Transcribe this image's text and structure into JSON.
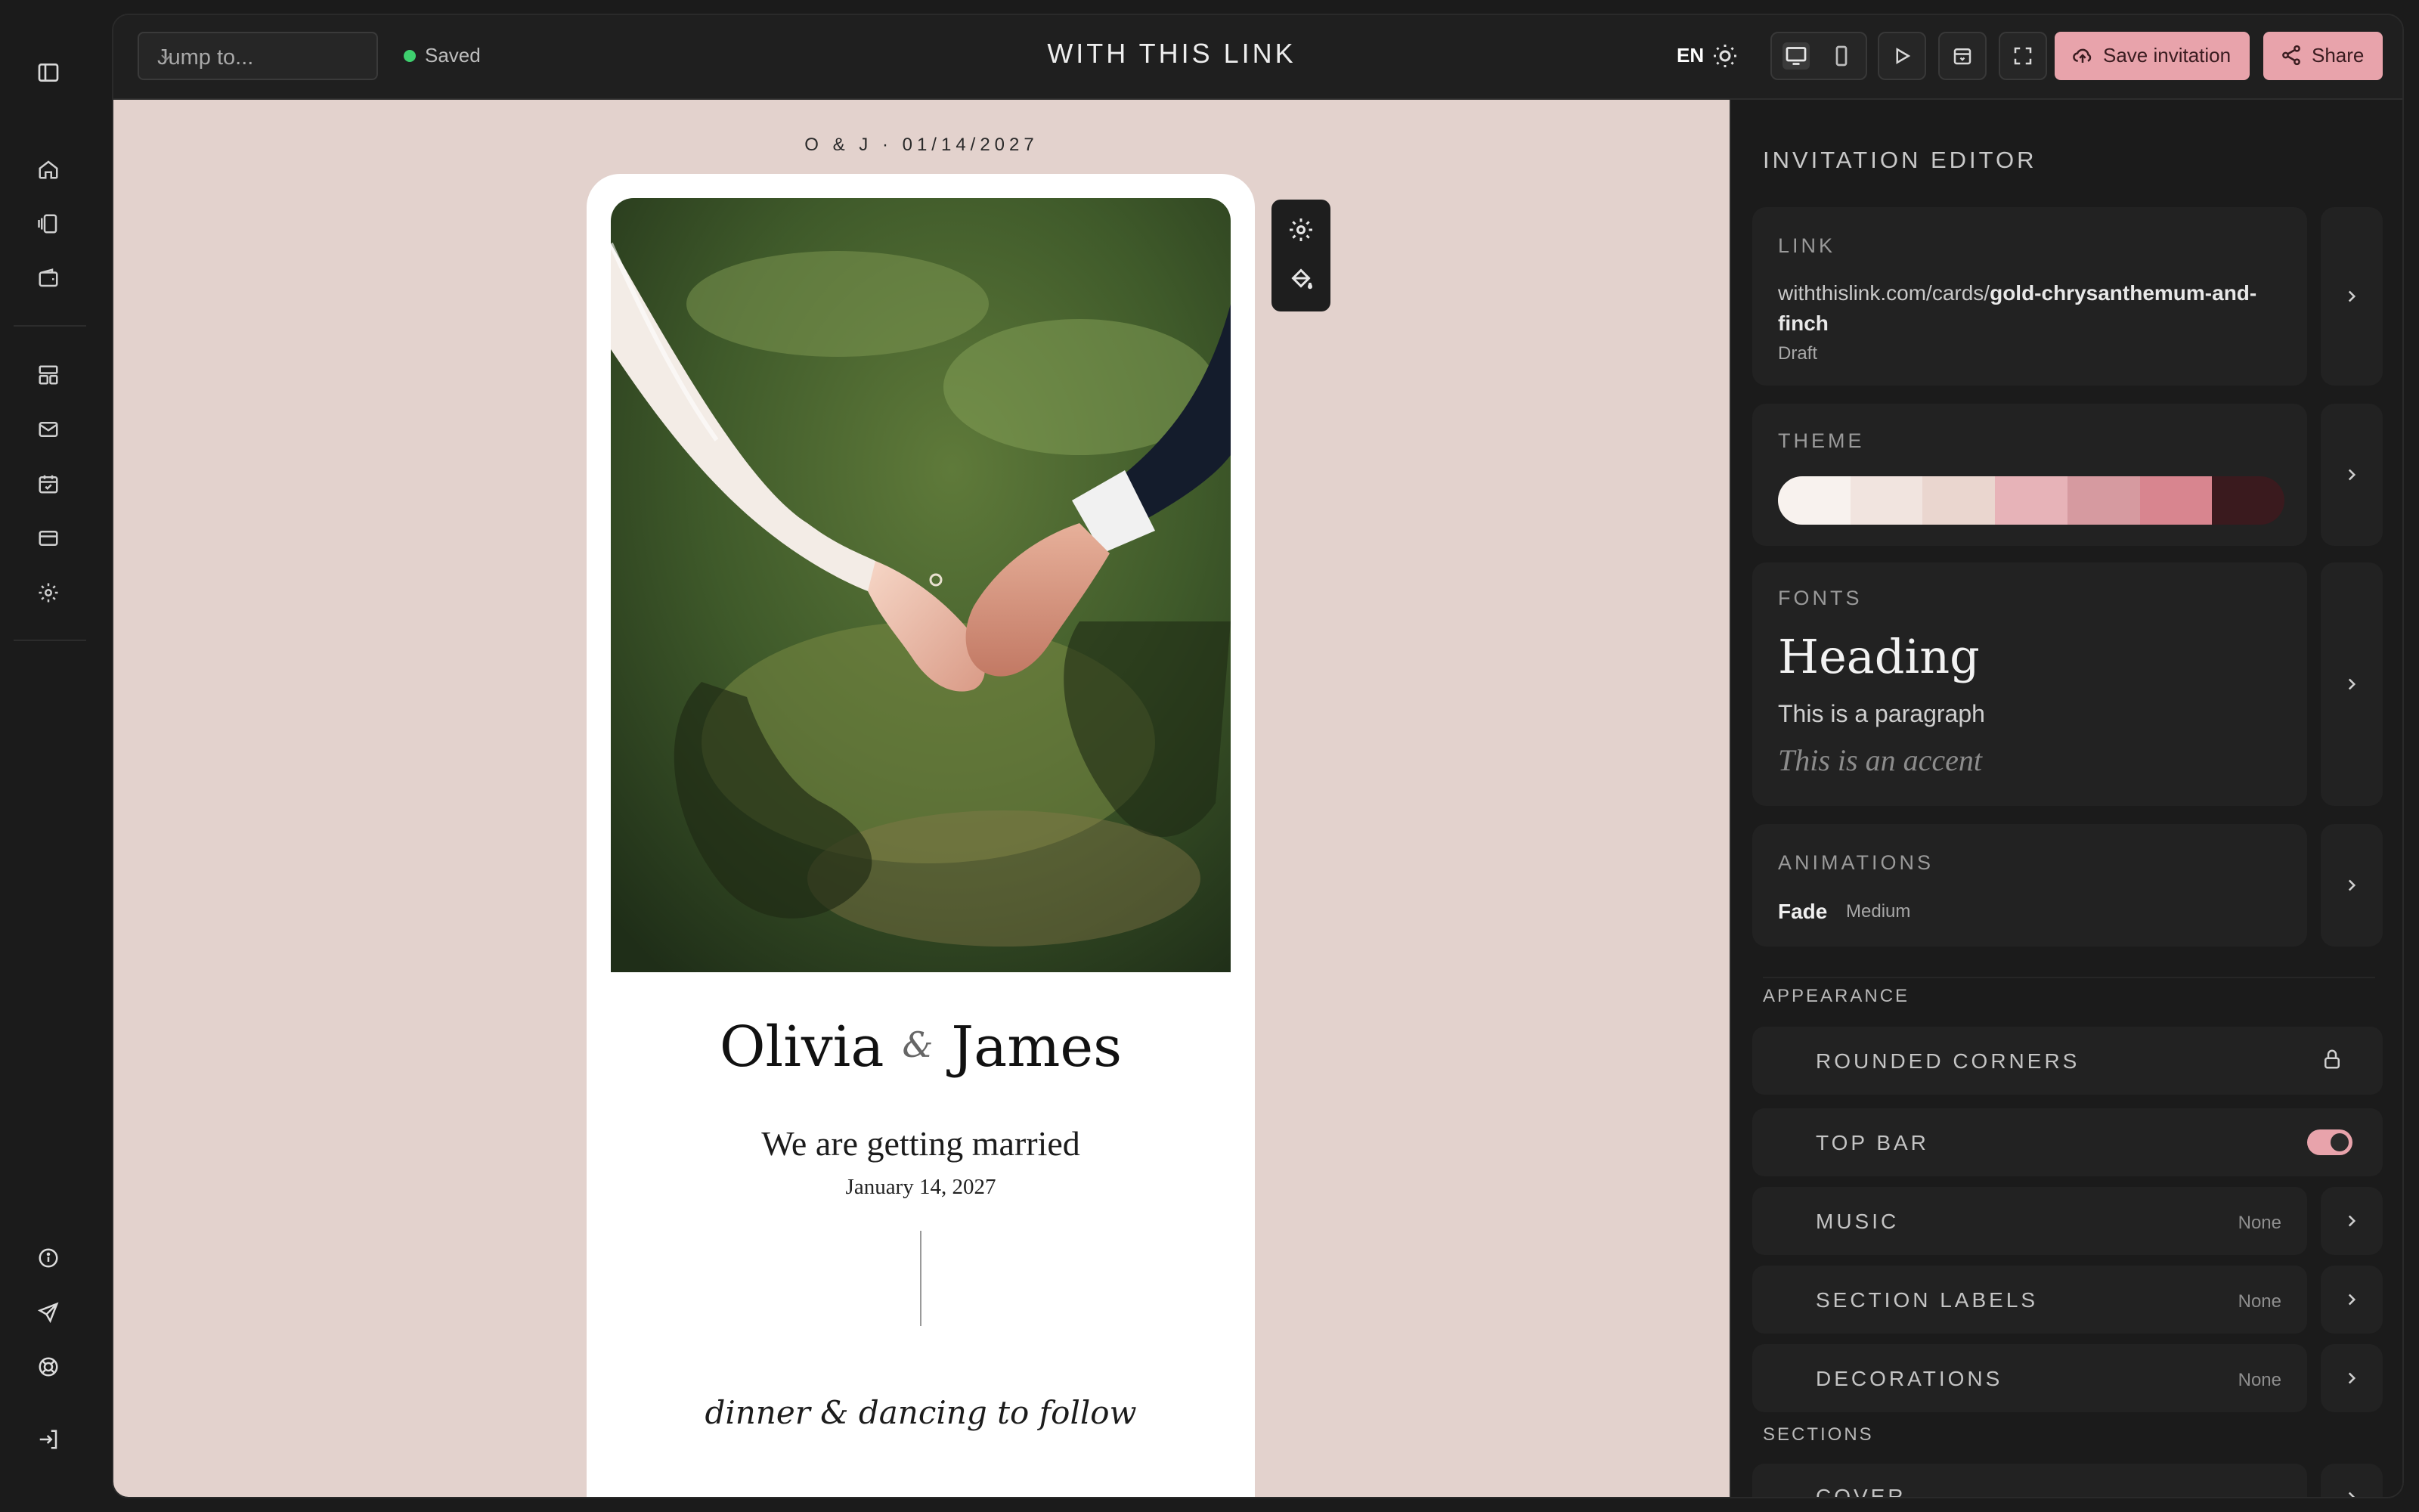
{
  "topbar": {
    "jump_placeholder": "Jump to...",
    "saved_status": "Saved",
    "app_title": "WITH THIS LINK",
    "language": "EN",
    "save_label": "Save invitation",
    "share_label": "Share"
  },
  "canvas": {
    "card_meta": "O & J  ·  01/14/2027",
    "name_left": "Olivia",
    "ampersand": "&",
    "name_right": "James",
    "tagline": "We are getting married",
    "date": "January 14, 2027",
    "follow_text": "dinner & dancing to follow"
  },
  "editor": {
    "title": "INVITATION EDITOR",
    "link": {
      "label": "LINK",
      "url_prefix": "withthislink.com/cards/",
      "url_slug": "gold-chrysanthemum-and-finch",
      "status": "Draft"
    },
    "theme": {
      "label": "THEME",
      "swatches": [
        "#f8f2ee",
        "#f1e4df",
        "#ead6cf",
        "#e7b3b8",
        "#d69aa0",
        "#d8858f",
        "#3a1a1e"
      ]
    },
    "fonts": {
      "label": "FONTS",
      "heading": "Heading",
      "paragraph": "This is a paragraph",
      "accent": "This is an accent"
    },
    "animations": {
      "label": "ANIMATIONS",
      "name": "Fade",
      "speed": "Medium"
    },
    "appearance_heading": "APPEARANCE",
    "appearance": {
      "rounded_corners": "ROUNDED CORNERS",
      "top_bar": "TOP BAR",
      "top_bar_on": true,
      "music": "MUSIC",
      "music_value": "None",
      "section_labels": "SECTION LABELS",
      "section_labels_value": "None",
      "decorations": "DECORATIONS",
      "decorations_value": "None"
    },
    "sections_heading": "SECTIONS",
    "sections": [
      "COVER"
    ]
  },
  "colors": {
    "accent": "#e8a3ab",
    "saved_dot": "#3ecf6e",
    "canvas_bg": "#e3d2cd"
  }
}
